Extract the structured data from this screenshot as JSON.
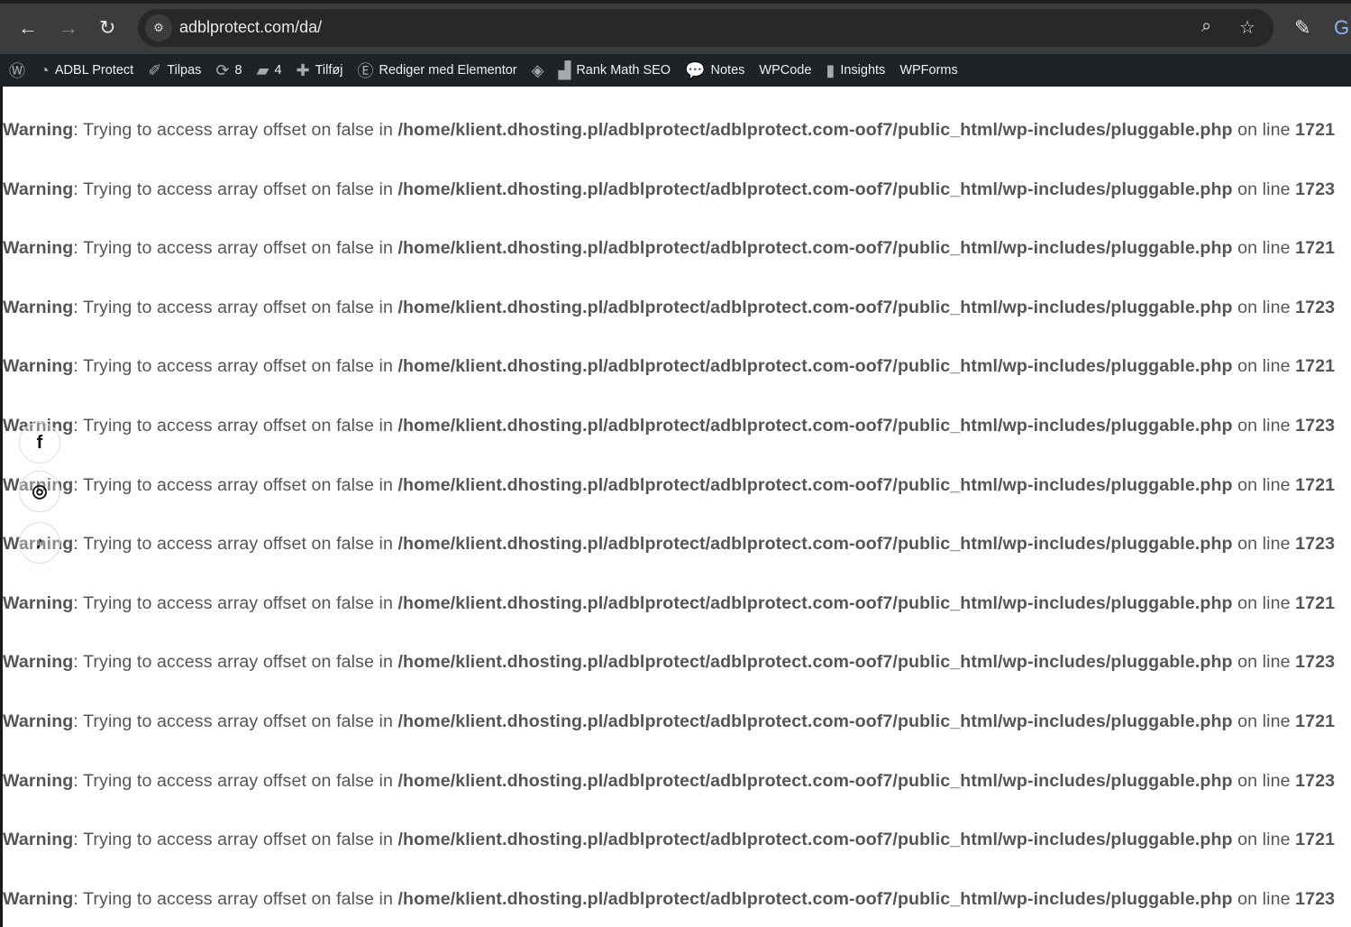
{
  "browser": {
    "url": "adblprotect.com/da/"
  },
  "adminbar": {
    "items": [
      {
        "icon": "wordpress-icon",
        "label": ""
      },
      {
        "icon": "dashboard-icon",
        "label": "ADBL Protect"
      },
      {
        "icon": "brush-icon",
        "label": "Tilpas"
      },
      {
        "icon": "updates-icon",
        "label": "8"
      },
      {
        "icon": "comment-icon",
        "label": "4"
      },
      {
        "icon": "plus-icon",
        "label": "Tilføj"
      },
      {
        "icon": "elementor-icon",
        "label": "Rediger med Elementor"
      },
      {
        "icon": "diamond-icon",
        "label": ""
      },
      {
        "icon": "rankmath-icon",
        "label": "Rank Math SEO"
      },
      {
        "icon": "notes-icon",
        "label": "Notes"
      },
      {
        "icon": "",
        "label": "WPCode"
      },
      {
        "icon": "insights-icon",
        "label": "Insights"
      },
      {
        "icon": "",
        "label": "WPForms"
      }
    ]
  },
  "warning": {
    "label": "Warning",
    "message": ": Trying to access array offset on false in ",
    "path": "/home/klient.dhosting.pl/adblprotect/adblprotect.com-oof7/public_html/wp-includes/pluggable.php",
    "online": " on line "
  },
  "lines": [
    "1721",
    "1723",
    "1721",
    "1723",
    "1721",
    "1723",
    "1721",
    "1723",
    "1721",
    "1723",
    "1721",
    "1723",
    "1721",
    "1723"
  ]
}
